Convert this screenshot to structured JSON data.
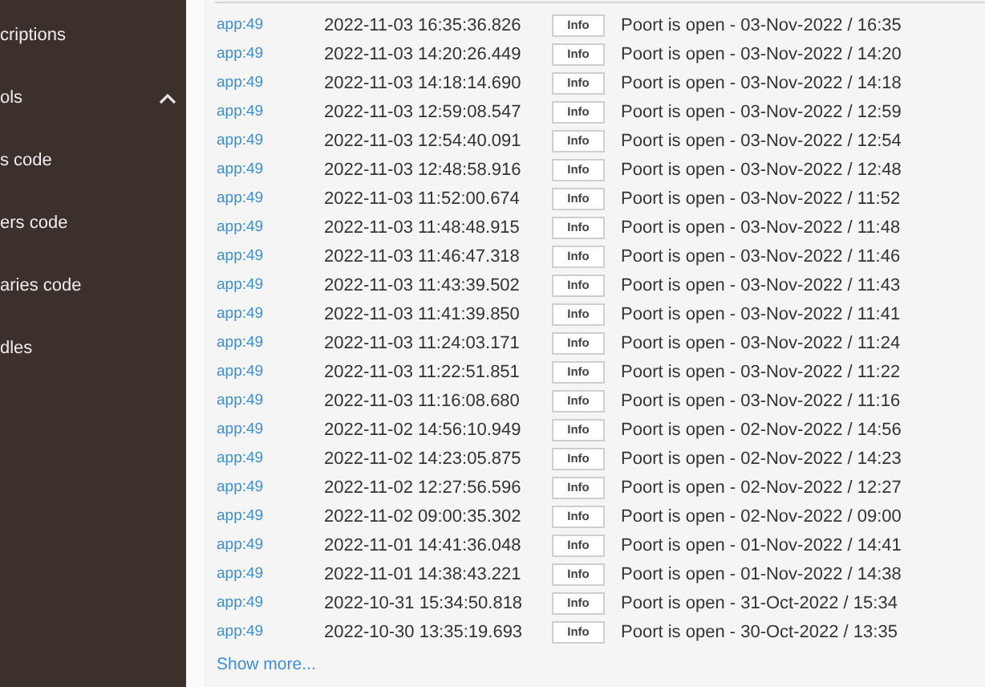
{
  "sidebar": {
    "items": [
      {
        "label": "criptions"
      },
      {
        "label": "ols",
        "expanded": true
      },
      {
        "label": "s code"
      },
      {
        "label": "ers code"
      },
      {
        "label": "aries code"
      },
      {
        "label": "dles"
      }
    ]
  },
  "log": {
    "rows": [
      {
        "source": "app:49",
        "timestamp": "2022-11-03 16:35:36.826",
        "level": "Info",
        "message": "Poort is open - 03-Nov-2022 / 16:35"
      },
      {
        "source": "app:49",
        "timestamp": "2022-11-03 14:20:26.449",
        "level": "Info",
        "message": "Poort is open - 03-Nov-2022 / 14:20"
      },
      {
        "source": "app:49",
        "timestamp": "2022-11-03 14:18:14.690",
        "level": "Info",
        "message": "Poort is open - 03-Nov-2022 / 14:18"
      },
      {
        "source": "app:49",
        "timestamp": "2022-11-03 12:59:08.547",
        "level": "Info",
        "message": "Poort is open - 03-Nov-2022 / 12:59"
      },
      {
        "source": "app:49",
        "timestamp": "2022-11-03 12:54:40.091",
        "level": "Info",
        "message": "Poort is open - 03-Nov-2022 / 12:54"
      },
      {
        "source": "app:49",
        "timestamp": "2022-11-03 12:48:58.916",
        "level": "Info",
        "message": "Poort is open - 03-Nov-2022 / 12:48"
      },
      {
        "source": "app:49",
        "timestamp": "2022-11-03 11:52:00.674",
        "level": "Info",
        "message": "Poort is open - 03-Nov-2022 / 11:52"
      },
      {
        "source": "app:49",
        "timestamp": "2022-11-03 11:48:48.915",
        "level": "Info",
        "message": "Poort is open - 03-Nov-2022 / 11:48"
      },
      {
        "source": "app:49",
        "timestamp": "2022-11-03 11:46:47.318",
        "level": "Info",
        "message": "Poort is open - 03-Nov-2022 / 11:46"
      },
      {
        "source": "app:49",
        "timestamp": "2022-11-03 11:43:39.502",
        "level": "Info",
        "message": "Poort is open - 03-Nov-2022 / 11:43"
      },
      {
        "source": "app:49",
        "timestamp": "2022-11-03 11:41:39.850",
        "level": "Info",
        "message": "Poort is open - 03-Nov-2022 / 11:41"
      },
      {
        "source": "app:49",
        "timestamp": "2022-11-03 11:24:03.171",
        "level": "Info",
        "message": "Poort is open - 03-Nov-2022 / 11:24"
      },
      {
        "source": "app:49",
        "timestamp": "2022-11-03 11:22:51.851",
        "level": "Info",
        "message": "Poort is open - 03-Nov-2022 / 11:22"
      },
      {
        "source": "app:49",
        "timestamp": "2022-11-03 11:16:08.680",
        "level": "Info",
        "message": "Poort is open - 03-Nov-2022 / 11:16"
      },
      {
        "source": "app:49",
        "timestamp": "2022-11-02 14:56:10.949",
        "level": "Info",
        "message": "Poort is open - 02-Nov-2022 / 14:56"
      },
      {
        "source": "app:49",
        "timestamp": "2022-11-02 14:23:05.875",
        "level": "Info",
        "message": "Poort is open - 02-Nov-2022 / 14:23"
      },
      {
        "source": "app:49",
        "timestamp": "2022-11-02 12:27:56.596",
        "level": "Info",
        "message": "Poort is open - 02-Nov-2022 / 12:27"
      },
      {
        "source": "app:49",
        "timestamp": "2022-11-02 09:00:35.302",
        "level": "Info",
        "message": "Poort is open - 02-Nov-2022 / 09:00"
      },
      {
        "source": "app:49",
        "timestamp": "2022-11-01 14:41:36.048",
        "level": "Info",
        "message": "Poort is open - 01-Nov-2022 / 14:41"
      },
      {
        "source": "app:49",
        "timestamp": "2022-11-01 14:38:43.221",
        "level": "Info",
        "message": "Poort is open - 01-Nov-2022 / 14:38"
      },
      {
        "source": "app:49",
        "timestamp": "2022-10-31 15:34:50.818",
        "level": "Info",
        "message": "Poort is open - 31-Oct-2022 / 15:34"
      },
      {
        "source": "app:49",
        "timestamp": "2022-10-30 13:35:19.693",
        "level": "Info",
        "message": "Poort is open - 30-Oct-2022 / 13:35"
      }
    ],
    "show_more": "Show more..."
  }
}
